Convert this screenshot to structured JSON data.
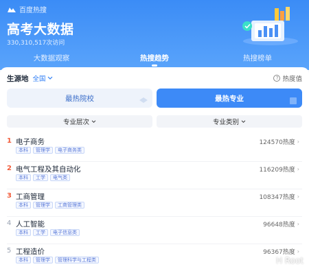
{
  "header": {
    "brand": "百度热搜",
    "title": "高考大数据",
    "visits": "330,310,517次访问"
  },
  "tabs": [
    {
      "label": "大数据观察"
    },
    {
      "label": "热搜趋势"
    },
    {
      "label": "热搜榜单"
    }
  ],
  "filters_top": {
    "origin_label": "生源地",
    "origin_value": "全国",
    "heat_help": "热度值"
  },
  "segment": {
    "left": "最热院校",
    "right": "最热专业"
  },
  "filters": {
    "level": "专业层次",
    "category": "专业类别"
  },
  "list": [
    {
      "rank": "1",
      "name": "电子商务",
      "heat": "124570热度",
      "tags": [
        "本科",
        "管理学",
        "电子商务类"
      ]
    },
    {
      "rank": "2",
      "name": "电气工程及其自动化",
      "heat": "116209热度",
      "tags": [
        "本科",
        "工学",
        "电气类"
      ]
    },
    {
      "rank": "3",
      "name": "工商管理",
      "heat": "108347热度",
      "tags": [
        "本科",
        "管理学",
        "工商管理类"
      ]
    },
    {
      "rank": "4",
      "name": "人工智能",
      "heat": "96648热度",
      "tags": [
        "本科",
        "工学",
        "电子信息类"
      ]
    },
    {
      "rank": "5",
      "name": "工程造价",
      "heat": "96367热度",
      "tags": [
        "本科",
        "管理学",
        "管理科学与工程类"
      ]
    }
  ],
  "watermark": "H Root",
  "colors": {
    "primary": "#3d8af7",
    "hot_rank": "#f25c3b",
    "tag_text": "#5a7ad8"
  }
}
